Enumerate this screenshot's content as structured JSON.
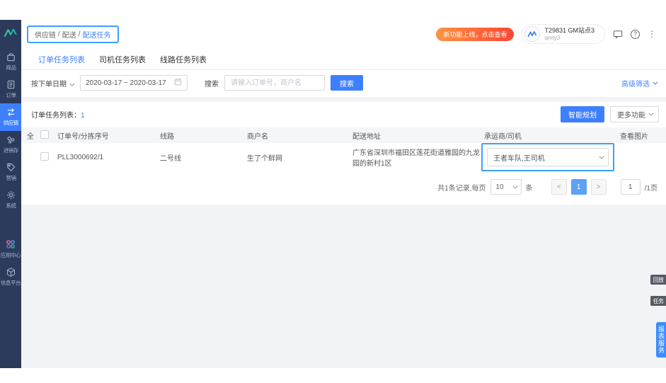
{
  "accent_color": "#3d7fff",
  "sidebar_color": "#2c3a5c",
  "highlight_border_color": "#3da0ff",
  "breadcrumb": {
    "item1": "供应链",
    "sep1": "/",
    "item2": "配送",
    "sep2": "/",
    "current": "配送任务"
  },
  "header": {
    "notice_badge": "新功能上线，点击查看",
    "user_name": "T29831 GM站点3",
    "user_sub": "qmty3"
  },
  "sidebar": {
    "items": [
      {
        "label": "商品",
        "icon": "bag-icon"
      },
      {
        "label": "订单",
        "icon": "order-icon"
      },
      {
        "label": "供应链",
        "icon": "supply-chain-icon"
      },
      {
        "label": "进销存",
        "icon": "inventory-icon"
      },
      {
        "label": "营销",
        "icon": "marketing-icon"
      },
      {
        "label": "系统",
        "icon": "gear-icon"
      },
      {
        "label": "应用中心",
        "icon": "app-center-icon"
      },
      {
        "label": "信息平台",
        "icon": "cube-icon"
      }
    ]
  },
  "tabs": [
    {
      "label": "订单任务列表"
    },
    {
      "label": "司机任务列表"
    },
    {
      "label": "线路任务列表"
    }
  ],
  "filters": {
    "date_type_label": "按下单日期",
    "date_range": "2020-03-17 ~ 2020-03-17",
    "search_label": "搜索",
    "search_placeholder": "请输入订单号，商户名",
    "search_button": "搜索",
    "advanced_filter": "高级筛选"
  },
  "list": {
    "title": "订单任务列表：",
    "count": "1",
    "smart_plan_button": "智能规划",
    "more_button": "更多功能",
    "columns": [
      "全",
      "订单号/分拣序号",
      "线路",
      "商户名",
      "配送地址",
      "承运商/司机",
      "查看图片"
    ],
    "rows": [
      {
        "order_no": "PLL3000692/1",
        "line": "二号线",
        "merchant": "生了个鲜网",
        "address": "广东省深圳市福田区莲花街道雅园的九龙园的新村1区",
        "carrier": "王者车队,王司机"
      }
    ]
  },
  "pagination": {
    "total_text": "共1条记录,每页",
    "page_size": "10",
    "unit": "条",
    "prev": "<",
    "current_page": "1",
    "next": ">",
    "jump_value": "1",
    "total_pages": "/1页"
  },
  "floating": {
    "tab1": "回放",
    "tab2": "任务",
    "vertical_tab": "报表服务"
  }
}
